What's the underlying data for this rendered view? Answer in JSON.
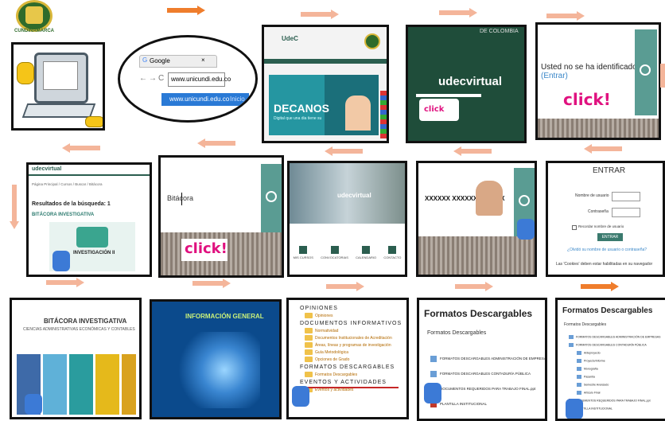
{
  "logo": {
    "text": "CUNDINAMARCA"
  },
  "browser_bubble": {
    "tab_title": "Google",
    "address": "www.unicundi.edu.co",
    "suggestion": "www.unicundi.edu.co",
    "suggestion_hint": "Inicio"
  },
  "decanos_panel": {
    "brand": "UdeC",
    "banner": "DECANOS",
    "banner_sub": "Digital que una dia tiene su"
  },
  "udecvirtual_panel": {
    "top": "DE COLOMBIA",
    "title": "udecvirtual"
  },
  "identify_panel": {
    "text": "Usted no se ha identificado.",
    "link": "(Entrar)"
  },
  "click_label": "click!",
  "click_small": "click",
  "search_results_panel": {
    "brand": "udecvirtual",
    "breadcrumb": "Página Principal / Cursos / Buscar / Bitácora",
    "results": "Resultados de la búsqueda: 1",
    "item": "BITÁCORA INVESTIGATIVA",
    "card_title": "INVESTIGACIÓN II"
  },
  "bitacora_search_panel": {
    "query": "Bitácora"
  },
  "home_panel": {
    "brand": "udecvirtual",
    "icons": [
      "MIS CURSOS",
      "CONVOCATORIAS",
      "CALENDARIO",
      "CONTACTO"
    ]
  },
  "user_panel": {
    "user": "XXXXXX XXXXXX XXXXXX"
  },
  "login_panel": {
    "title": "ENTRAR",
    "username_label": "Nombre de usuario",
    "password_label": "Contraseña",
    "remember_label": "Recordar nombre de usuario",
    "button": "ENTRAR",
    "forgot": "¿Olvidó su nombre de usuario o contraseña?",
    "cookies": "Las 'Cookies' deben estar habilitadas en su navegador"
  },
  "bitacora_panel": {
    "title": "BITÁCORA INVESTIGATIVA",
    "subtitle": "CIENCIAS ADMINISTRATIVAS ECONÓMICAS Y CONTABLES"
  },
  "info_panel": {
    "title": "INFORMACIÓN GENERAL"
  },
  "menu_panel": {
    "items": [
      {
        "label": "OPINIONES",
        "header": true
      },
      {
        "label": "Opiniones",
        "header": false
      },
      {
        "label": "DOCUMENTOS INFORMATIVOS",
        "header": true
      },
      {
        "label": "Normatividad",
        "header": false
      },
      {
        "label": "Documentos Institucionales de Acreditación",
        "header": false
      },
      {
        "label": "Áreas, líneas y programas de investigación",
        "header": false
      },
      {
        "label": "Guía Metodológica",
        "header": false
      },
      {
        "label": "Opciones de Grado",
        "header": false
      },
      {
        "label": "FORMATOS DESCARGABLES",
        "header": true
      },
      {
        "label": "Formatos Descargables",
        "header": false
      },
      {
        "label": "EVENTOS Y ACTIVIDADES",
        "header": true
      },
      {
        "label": "Eventos y actividades",
        "header": false
      }
    ]
  },
  "formatos_panel": {
    "title": "Formatos Descargables",
    "subtitle": "Formatos Descargables",
    "items": [
      "FORMATOS DESCARGABLES ADMINISTRACIÓN DE EMPRESAS",
      "FORMATOS DESCARGABLES CONTADURÍA PÚBLICA",
      "DOCUMENTOS REQUERIDOS PARA TRABAJO FINAL.ppt",
      "PLANTILLA INSTITUCIONAL"
    ]
  },
  "formatos_tree_panel": {
    "title": "Formatos Descargables",
    "subtitle": "Formatos Descargables",
    "items": [
      "FORMATOS DESCARGABLES ADMINISTRACIÓN DE EMPRESAS",
      "FORMATOS DESCARGABLES CONTADURÍA PÚBLICA",
      "Anteproyecto",
      "Proyecto/Informe",
      "Monografía",
      "Pasantía",
      "Semestre Avanzado",
      "Artículo Final",
      "DOCUMENTOS REQUERIDOS PARA TRABAJO FINAL.ppt",
      "PLANTILLA INSTITUCIONAL"
    ]
  },
  "colors": {
    "teal": "#5a9c93",
    "dark_green": "#1f4d3a",
    "magenta": "#e0117f",
    "arrow": "#f4b59a",
    "arrow_strong": "#ef7d2c"
  }
}
